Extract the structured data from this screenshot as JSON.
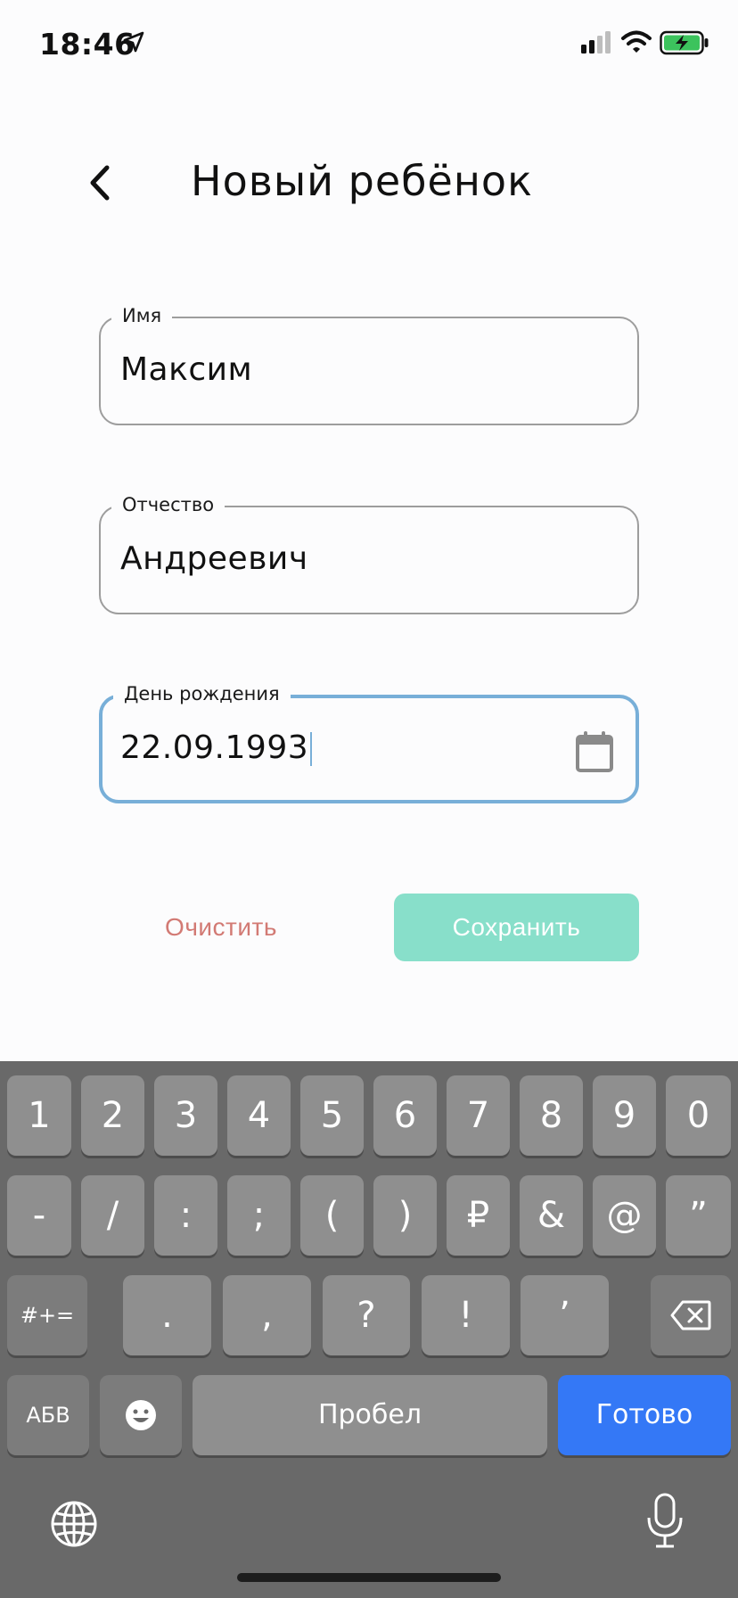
{
  "status_bar": {
    "time": "18:46"
  },
  "header": {
    "title": "Новый ребёнок"
  },
  "fields": {
    "first_name": {
      "label": "Имя",
      "value": "Максим"
    },
    "patronymic": {
      "label": "Отчество",
      "value": "Андреевич"
    },
    "birthday": {
      "label": "День рождения",
      "value": "22.09.1993"
    }
  },
  "actions": {
    "clear_label": "Очистить",
    "save_label": "Сохранить"
  },
  "keyboard": {
    "row1": [
      "1",
      "2",
      "3",
      "4",
      "5",
      "6",
      "7",
      "8",
      "9",
      "0"
    ],
    "row2": [
      "-",
      "/",
      ":",
      ";",
      "(",
      ")",
      "₽",
      "&",
      "@",
      "”"
    ],
    "row3": [
      ".",
      ",",
      "?",
      "!",
      "’"
    ],
    "symbols_label": "#+=",
    "abc_label": "АБВ",
    "space_label": "Пробел",
    "done_label": "Готово"
  },
  "colors": {
    "accent_blue": "#3478f6",
    "focus_border": "#78afd8",
    "save_bg": "#88dfca",
    "clear_text": "#d27a74"
  }
}
